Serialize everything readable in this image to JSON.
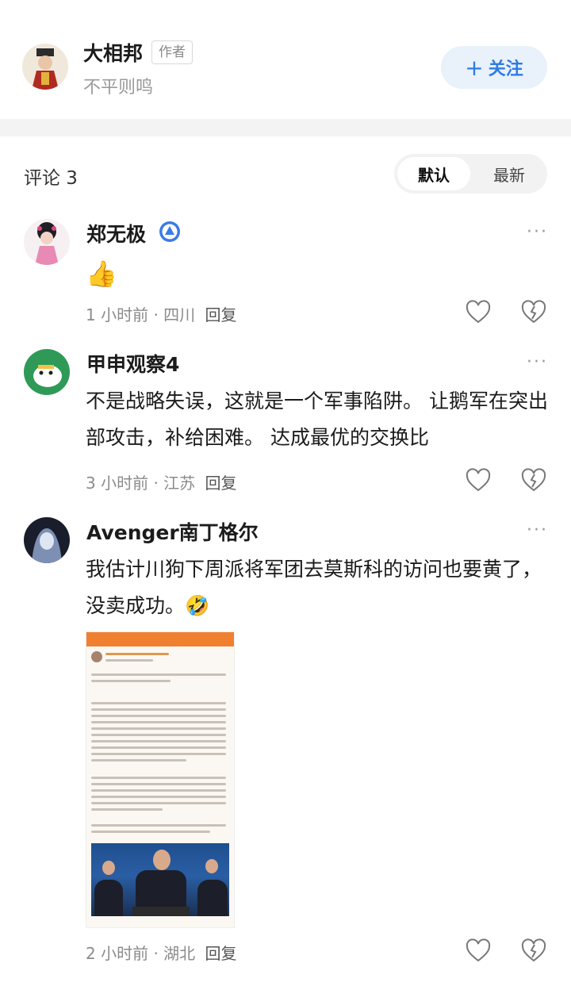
{
  "author": {
    "name": "大相邦",
    "tag": "作者",
    "signature": "不平则鸣",
    "follow_label": "关注"
  },
  "comments_section": {
    "title": "评论 3",
    "sort_options": [
      "默认",
      "最新"
    ],
    "selected_sort": "默认"
  },
  "comments": [
    {
      "username": "郑无极",
      "has_badge": true,
      "emoji": "👍",
      "time": "1 小时前",
      "location": "四川",
      "reply_label": "回复"
    },
    {
      "username": "甲申观察4",
      "text": "不是战略失误，这就是一个军事陷阱。 让鹅军在突出部攻击，补给困难。 达成最优的交换比",
      "time": "3 小时前",
      "location": "江苏",
      "reply_label": "回复"
    },
    {
      "username": "Avenger南丁格尔",
      "text": "我估计川狗下周派将军团去莫斯科的访问也要黄了，没卖成功。🤣",
      "has_image": true,
      "time": "2 小时前",
      "location": "湖北",
      "reply_label": "回复"
    }
  ],
  "icons": {
    "more": "more-dots-icon",
    "like": "heart-icon",
    "dislike": "broken-heart-icon",
    "badge": "verified-badge-icon",
    "follow": "plus-icon"
  },
  "colors": {
    "accent": "#2e7be6",
    "follow_bg": "#e9f1fb",
    "muted": "#8b8b8b"
  }
}
